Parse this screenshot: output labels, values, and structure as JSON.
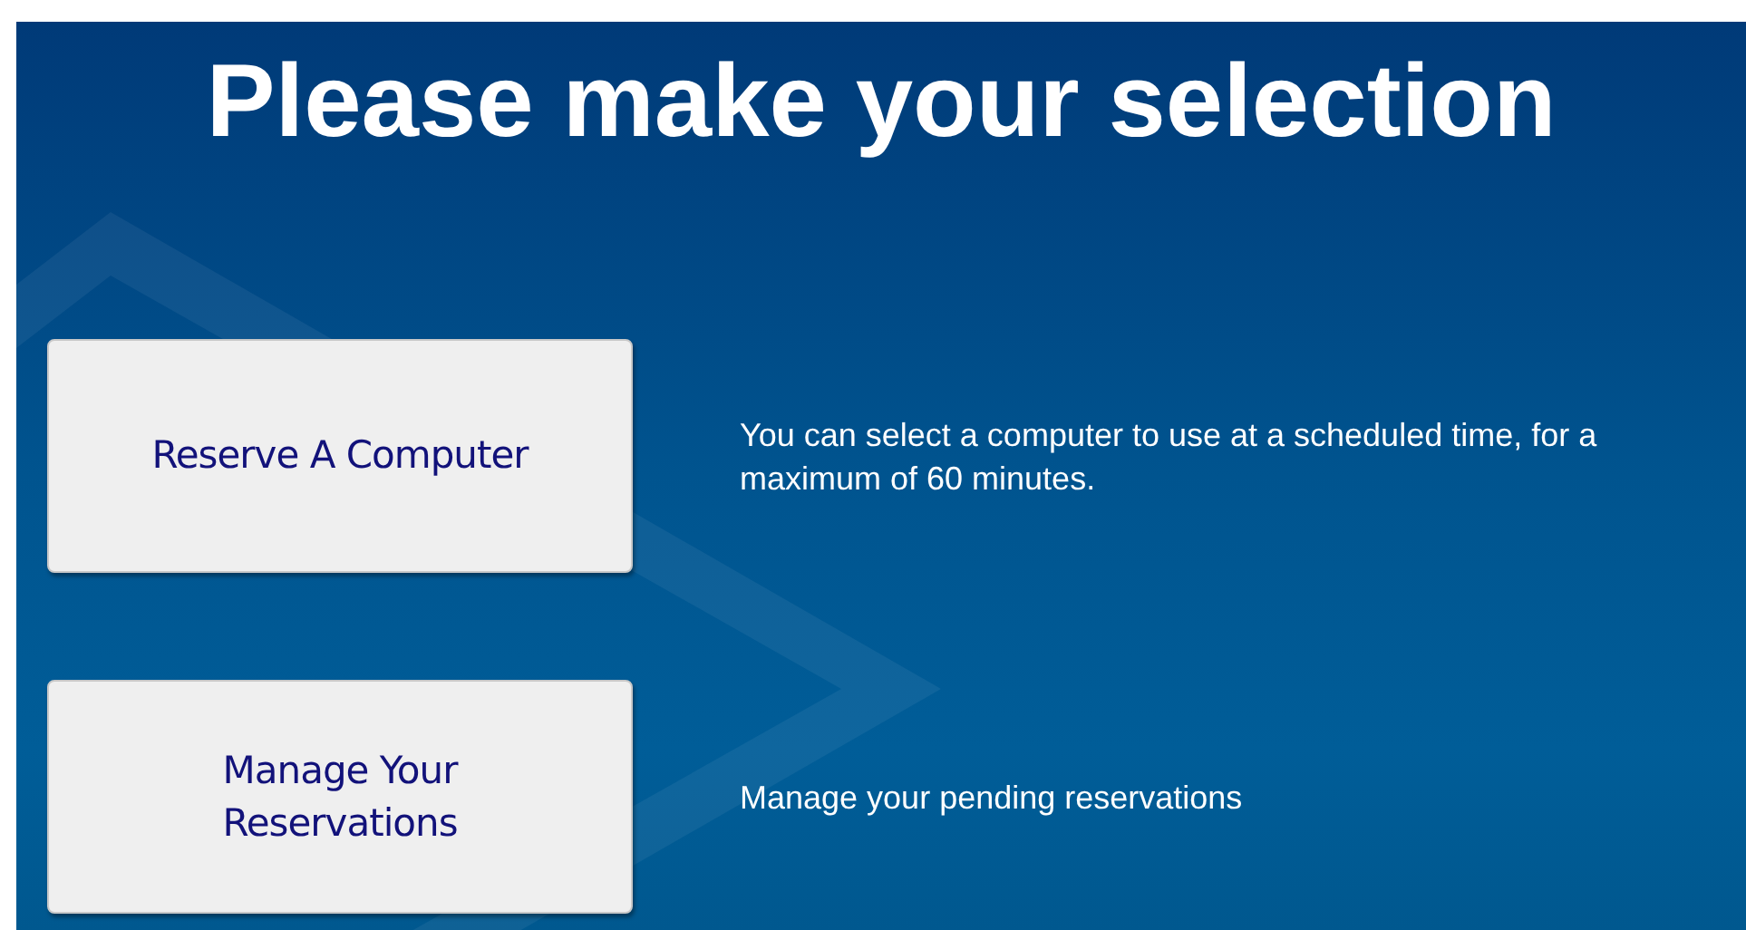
{
  "title": "Please make your selection",
  "options": [
    {
      "label": "Reserve A Computer",
      "description": "You can select a computer to use at a scheduled time, for a maximum of 60 minutes."
    },
    {
      "label": "Manage Your Reservations",
      "description": "Manage your pending reservations"
    }
  ]
}
